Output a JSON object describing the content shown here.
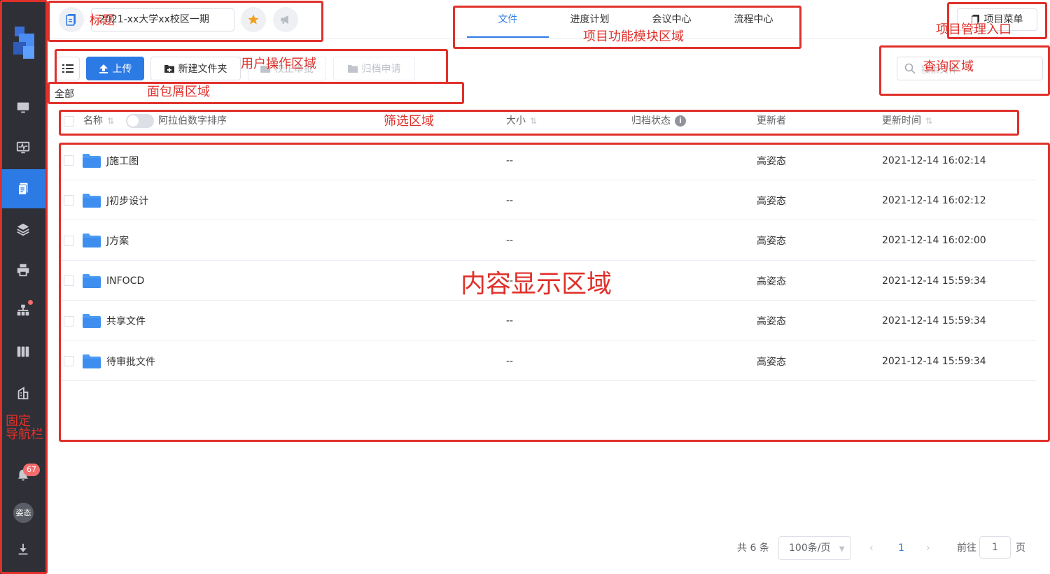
{
  "header": {
    "title_value": "2021-xx大学xx校区一期",
    "tabs": [
      {
        "label": "文件"
      },
      {
        "label": "进度计划"
      },
      {
        "label": "会议中心"
      },
      {
        "label": "流程中心"
      }
    ],
    "project_menu_label": "项目菜单"
  },
  "toolbar": {
    "upload_label": "上传",
    "new_folder_label": "新建文件夹",
    "approval_label": "校正审批",
    "archive_label": "归档申请",
    "search_placeholder": "搜索文件"
  },
  "breadcrumb": {
    "root": "全部"
  },
  "table": {
    "columns": {
      "name": "名称",
      "sort_toggle": "阿拉伯数字排序",
      "size": "大小",
      "archive_status": "归档状态",
      "updater": "更新者",
      "updated_at": "更新时间"
    },
    "rows": [
      {
        "name": "J施工图",
        "size": "--",
        "updater": "高姿态",
        "updated_at": "2021-12-14 16:02:14"
      },
      {
        "name": "J初步设计",
        "size": "--",
        "updater": "高姿态",
        "updated_at": "2021-12-14 16:02:12"
      },
      {
        "name": "J方案",
        "size": "--",
        "updater": "高姿态",
        "updated_at": "2021-12-14 16:02:00"
      },
      {
        "name": "INFOCD",
        "size": "--",
        "updater": "高姿态",
        "updated_at": "2021-12-14 15:59:34"
      },
      {
        "name": "共享文件",
        "size": "--",
        "updater": "高姿态",
        "updated_at": "2021-12-14 15:59:34"
      },
      {
        "name": "待审批文件",
        "size": "--",
        "updater": "高姿态",
        "updated_at": "2021-12-14 15:59:34"
      }
    ]
  },
  "sidebar": {
    "notification_count": "67",
    "avatar_text": "姿态"
  },
  "pagination": {
    "total": "共 6 条",
    "page_size": "100条/页",
    "current_page": "1",
    "goto_prefix": "前往",
    "goto_value": "1",
    "goto_suffix": "页"
  },
  "annotations": {
    "title": "标题",
    "modules": "项目功能模块区域",
    "project_mgmt": "项目管理入口",
    "user_ops": "用户操作区域",
    "query": "查询区域",
    "breadcrumb": "面包屑区域",
    "filter": "筛选区域",
    "content": "内容显示区域",
    "nav_line1": "固定",
    "nav_line2": "导航栏"
  },
  "colors": {
    "primary": "#2c7be5",
    "sidebar_bg": "#2f3037",
    "annotation": "#e0302a",
    "star": "#f0a020"
  }
}
